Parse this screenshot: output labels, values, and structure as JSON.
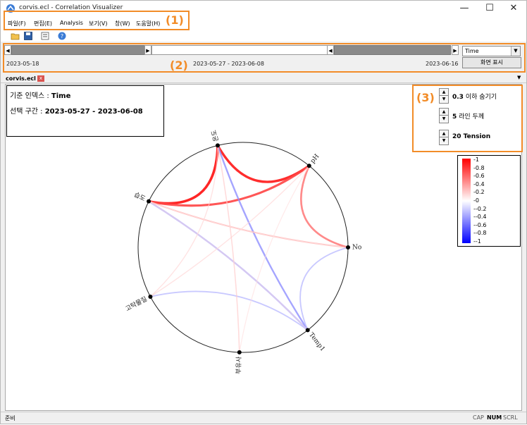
{
  "window": {
    "title": "corvis.ecl - Correlation Visualizer",
    "minimize": "—",
    "maximize": "☐",
    "close": "✕"
  },
  "menu": [
    "파일(F)",
    "편집(E)",
    "Analysis",
    "보기(V)",
    "창(W)",
    "도움말(H)"
  ],
  "annotations": [
    "(1)",
    "(2)",
    "(3)"
  ],
  "range": {
    "index_select": "Time",
    "start_date": "2023-05-18",
    "selection": "2023-05-27  -  2023-06-08",
    "end_date": "2023-06-16",
    "show_button": "화면 표시"
  },
  "doc_tab": {
    "label": "corvis.ecl",
    "close": "x"
  },
  "info": {
    "index_label": "기준 인덱스 : ",
    "index_value": "Time",
    "range_label": "선택 구간 : ",
    "range_value": "2023-05-27  -  2023-06-08"
  },
  "controls": [
    {
      "value": "0.3",
      "label": " 이하 숨기기"
    },
    {
      "value": "5",
      "label": " 라인 두께"
    },
    {
      "value": "20",
      "label": " Tension"
    }
  ],
  "legend": {
    "ticks": [
      "1",
      "0.8",
      "0.6",
      "0.4",
      "0.2",
      "0",
      "-0.2",
      "-0.4",
      "-0.6",
      "-0.8",
      "-1"
    ],
    "color_high": "#ff0000",
    "color_mid": "#ffffff",
    "color_low": "#0000ff"
  },
  "nodes": [
    {
      "id": "temp",
      "label": "온도"
    },
    {
      "id": "ph",
      "label": "pH"
    },
    {
      "id": "no",
      "label": "No"
    },
    {
      "id": "temp1",
      "label": "Temp1"
    },
    {
      "id": "ss",
      "label": "부유사"
    },
    {
      "id": "turb",
      "label": "고탁물질"
    },
    {
      "id": "mois",
      "label": "습도"
    }
  ],
  "links": [
    {
      "from": "temp",
      "to": "ph",
      "r": 0.9
    },
    {
      "from": "temp",
      "to": "mois",
      "r": 0.92
    },
    {
      "from": "mois",
      "to": "ph",
      "r": 0.8
    },
    {
      "from": "temp",
      "to": "temp1",
      "r": -0.55
    },
    {
      "from": "mois",
      "to": "temp1",
      "r": -0.5
    },
    {
      "from": "mois",
      "to": "no",
      "r": 0.45
    },
    {
      "from": "ph",
      "to": "no",
      "r": 0.65
    },
    {
      "from": "no",
      "to": "temp1",
      "r": -0.4
    },
    {
      "from": "turb",
      "to": "temp1",
      "r": -0.4
    },
    {
      "from": "ph",
      "to": "turb",
      "r": 0.25
    },
    {
      "from": "temp",
      "to": "ss",
      "r": 0.3
    },
    {
      "from": "temp",
      "to": "turb",
      "r": 0.25
    },
    {
      "from": "mois",
      "to": "temp1",
      "r": 0.2
    },
    {
      "from": "ph",
      "to": "ss",
      "r": 0.2
    },
    {
      "from": "no",
      "to": "mois",
      "r": 0.15
    }
  ],
  "status": {
    "left": "준비",
    "cap": "CAP",
    "num": "NUM",
    "scrl": "SCRL"
  }
}
